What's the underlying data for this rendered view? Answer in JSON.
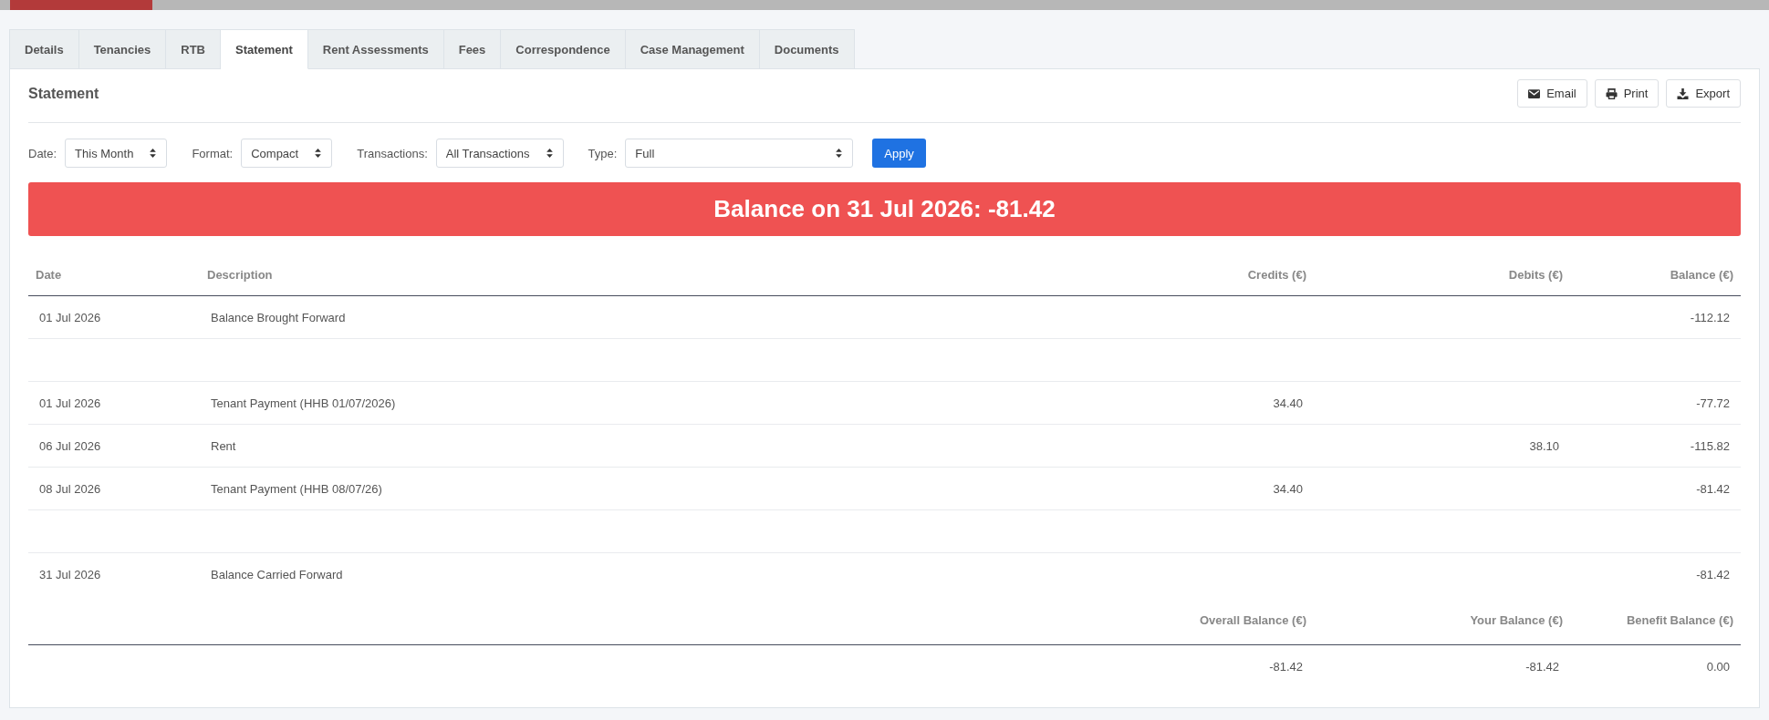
{
  "tabs": [
    {
      "label": "Details",
      "selected": false
    },
    {
      "label": "Tenancies",
      "selected": false
    },
    {
      "label": "RTB",
      "selected": false
    },
    {
      "label": "Statement",
      "selected": true
    },
    {
      "label": "Rent Assessments",
      "selected": false
    },
    {
      "label": "Fees",
      "selected": false
    },
    {
      "label": "Correspondence",
      "selected": false
    },
    {
      "label": "Case Management",
      "selected": false
    },
    {
      "label": "Documents",
      "selected": false
    }
  ],
  "panel": {
    "title": "Statement",
    "actions": [
      {
        "label": "Email",
        "kind": "email"
      },
      {
        "label": "Print",
        "kind": "print"
      },
      {
        "label": "Export",
        "kind": "export"
      }
    ]
  },
  "filters": [
    {
      "label": "Date:",
      "value": "This Month"
    },
    {
      "label": "Format:",
      "value": "Compact"
    },
    {
      "label": "Transactions:",
      "value": "All Transactions"
    },
    {
      "label": "Type:",
      "value": "Full"
    }
  ],
  "apply_button": "Apply",
  "balance_banner": "Balance on 31 Jul 2026: -81.42",
  "statement_table": {
    "columns": [
      "Date",
      "Description",
      "Credits (€)",
      "Debits (€)",
      "Balance (€)"
    ],
    "rows": [
      {
        "kind": "entry",
        "date": "01 Jul 2026",
        "description": "Balance Brought Forward",
        "balance": "-112.12"
      },
      {
        "kind": "blank"
      },
      {
        "kind": "entry",
        "date": "01 Jul 2026",
        "description": "Tenant Payment (HHB 01/07/2026)",
        "credit": "34.40",
        "balance": "-77.72"
      },
      {
        "kind": "entry",
        "date": "06 Jul 2026",
        "description": "Rent",
        "debit": "38.10",
        "balance": "-115.82"
      },
      {
        "kind": "entry",
        "date": "08 Jul 2026",
        "description": "Tenant Payment (HHB 08/07/26)",
        "credit": "34.40",
        "balance": "-81.42"
      },
      {
        "kind": "blank"
      },
      {
        "kind": "entry",
        "date": "31 Jul 2026",
        "description": "Balance Carried Forward",
        "balance": "-81.42"
      }
    ]
  },
  "summary": {
    "columns": [
      "Overall Balance (€)",
      "Your Balance (€)",
      "Benefit Balance (€)"
    ],
    "values": [
      "-81.42",
      "-81.42",
      "0.00"
    ]
  }
}
